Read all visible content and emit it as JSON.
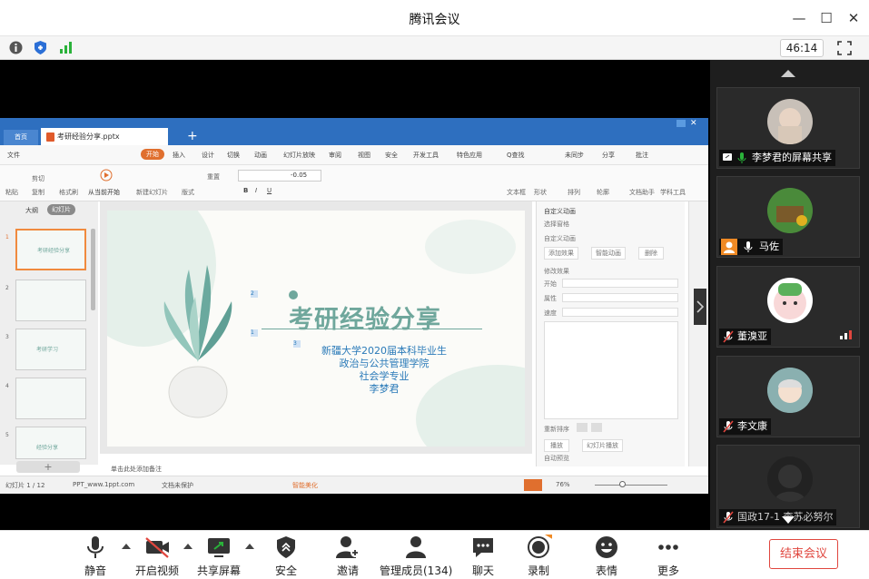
{
  "window": {
    "title": "腾讯会议",
    "timer": "46:14"
  },
  "wps": {
    "home_tab": "首页",
    "file_tab": "考研经验分享.pptx",
    "menu": [
      "文件",
      "开始",
      "插入",
      "设计",
      "切换",
      "动画",
      "幻灯片放映",
      "审阅",
      "视图",
      "安全",
      "开发工具",
      "特色应用",
      "Q查找",
      "未同步",
      "分享",
      "批注"
    ],
    "ribbon": [
      "粘贴",
      "剪切",
      "复制",
      "格式刷",
      "从当前开始",
      "新建幻灯片",
      "版式",
      "重置",
      "节",
      "文本框",
      "形状",
      "排列",
      "轮廓",
      "文档助手",
      "学科工具"
    ],
    "font_size": "-0.05",
    "panel_tabs": [
      "大纲",
      "幻灯片"
    ],
    "slide_title": "考研经验分享",
    "slide_lines": [
      "新疆大学2020届本科毕业生",
      "政治与公共管理学院",
      "社会学专业",
      "李梦君"
    ],
    "thumb_numbers": [
      "1",
      "2",
      "3",
      "4",
      "5"
    ],
    "thumb_texts": [
      "考研经验分享",
      "",
      "考研学习",
      "",
      "经验分享"
    ],
    "notes_placeholder": "单击此处添加备注",
    "right_panel": [
      "自定义动画",
      "选择窗格",
      "自定义动画",
      "添加效果",
      "智能动画",
      "删除",
      "修改效果",
      "开始",
      "属性",
      "速度",
      "重新排序",
      "播放",
      "幻灯片播放",
      "自动预览"
    ],
    "status": {
      "slide": "幻灯片 1 / 12",
      "theme": "PPT_www.1ppt.com",
      "doc": "文档未保护",
      "beautify": "智能美化",
      "zoom": "76%"
    }
  },
  "participants": [
    {
      "name": "李梦君的屏幕共享",
      "mic": "on",
      "tag": "screen"
    },
    {
      "name": "马佐",
      "mic": "on",
      "tag": "host"
    },
    {
      "name": "董溴亚",
      "mic": "off",
      "tag": "volume"
    },
    {
      "name": "李文康",
      "mic": "off",
      "tag": ""
    },
    {
      "name": "国政17-1 李苏必努尔",
      "mic": "off",
      "tag": ""
    }
  ],
  "toolbar": [
    {
      "label": "静音",
      "icon": "microphone-icon"
    },
    {
      "label": "开启视频",
      "icon": "camera-off-icon"
    },
    {
      "label": "共享屏幕",
      "icon": "share-screen-icon"
    },
    {
      "label": "安全",
      "icon": "shield-icon"
    },
    {
      "label": "邀请",
      "icon": "add-user-icon"
    },
    {
      "label": "管理成员(134)",
      "icon": "members-icon"
    },
    {
      "label": "聊天",
      "icon": "chat-icon"
    },
    {
      "label": "录制",
      "icon": "record-icon"
    },
    {
      "label": "表情",
      "icon": "emoji-icon"
    },
    {
      "label": "更多",
      "icon": "more-icon"
    }
  ],
  "end_label": "结束会议",
  "colors": {
    "accent": "#2e6fbf",
    "end": "#e0463e",
    "slide_title": "#6fa79c"
  }
}
